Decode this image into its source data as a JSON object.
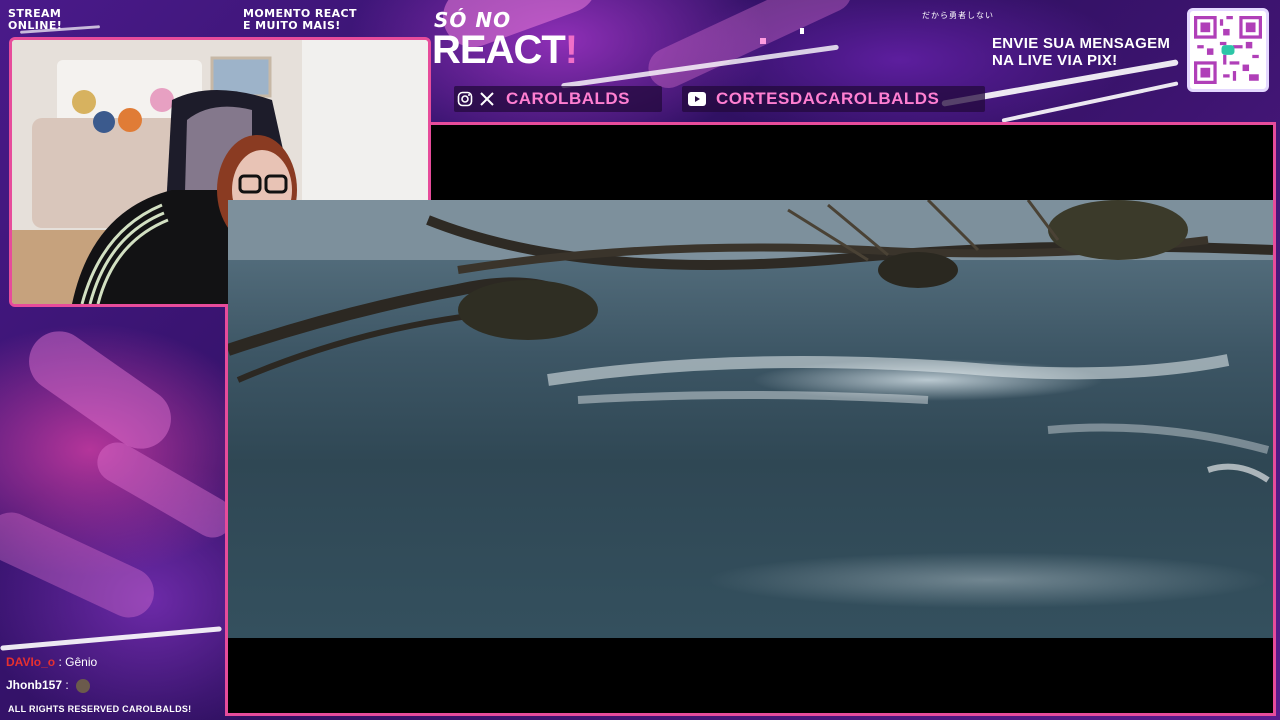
{
  "header": {
    "stream_status_line1": "STREAM",
    "stream_status_line2": "ONLINE!",
    "moment_line1": "MOMENTO REACT",
    "moment_line2": "E MUITO MAIS!",
    "logo_top": "SÓ NO",
    "logo_main": "REACT",
    "logo_bang": "!",
    "jp_text": "だから勇者しない",
    "pix_line1": "ENVIE SUA MENSAGEM",
    "pix_line2": "NA LIVE VIA PIX!"
  },
  "social": {
    "handle_main": "CAROLBALDS",
    "handle_cuts": "CORTESDACAROLBALDS",
    "icons": [
      "instagram-icon",
      "x-icon",
      "youtube-icon"
    ]
  },
  "chat": {
    "messages": [
      {
        "user": "DAVIo_o",
        "text": "Gênio",
        "user_color": "#e53030"
      },
      {
        "user": "Jhonb157",
        "text": "",
        "emote": "avatar-emote",
        "user_color": "#ffffff"
      }
    ]
  },
  "footer": {
    "text": "ALL RIGHTS RESERVED CAROLBALDS!"
  },
  "colors": {
    "accent_pink": "#e74c9b",
    "handle_pink": "#ff7fd1",
    "background_purple": "#3b1770"
  }
}
